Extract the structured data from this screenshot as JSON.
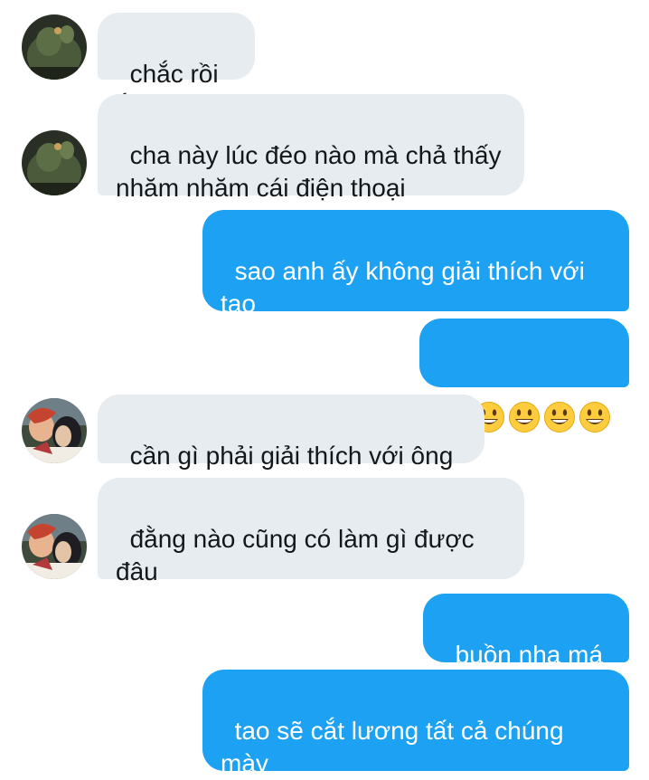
{
  "conversation": {
    "messages": [
      {
        "side": "in",
        "avatar": "green-figure-avatar",
        "text": "chắc rồi ắ"
      },
      {
        "side": "in",
        "avatar": "green-figure-avatar",
        "text": "cha này lúc đéo nào mà chả thấy nhăm nhăm cái điện thoại"
      },
      {
        "side": "out",
        "text": "sao anh ấy không giải thích với tao"
      },
      {
        "side": "out",
        "emoji": [
          "smiley-emoji",
          "smiley-emoji",
          "smiley-emoji",
          "smiley-emoji",
          "smiley-emoji"
        ]
      },
      {
        "side": "in",
        "avatar": "anime-character-avatar",
        "text": "cần gì phải giải thích với ông"
      },
      {
        "side": "in",
        "avatar": "anime-character-avatar",
        "text": "đằng nào cũng có làm gì được đâu"
      },
      {
        "side": "out",
        "text": "buồn nha má"
      },
      {
        "side": "out",
        "text": "tao sẽ cắt lương tất cả chúng mày"
      }
    ]
  },
  "colors": {
    "incoming_bubble": "#e6ecf0",
    "outgoing_bubble": "#1da1f2",
    "incoming_text": "#14171a",
    "outgoing_text": "#ffffff"
  }
}
